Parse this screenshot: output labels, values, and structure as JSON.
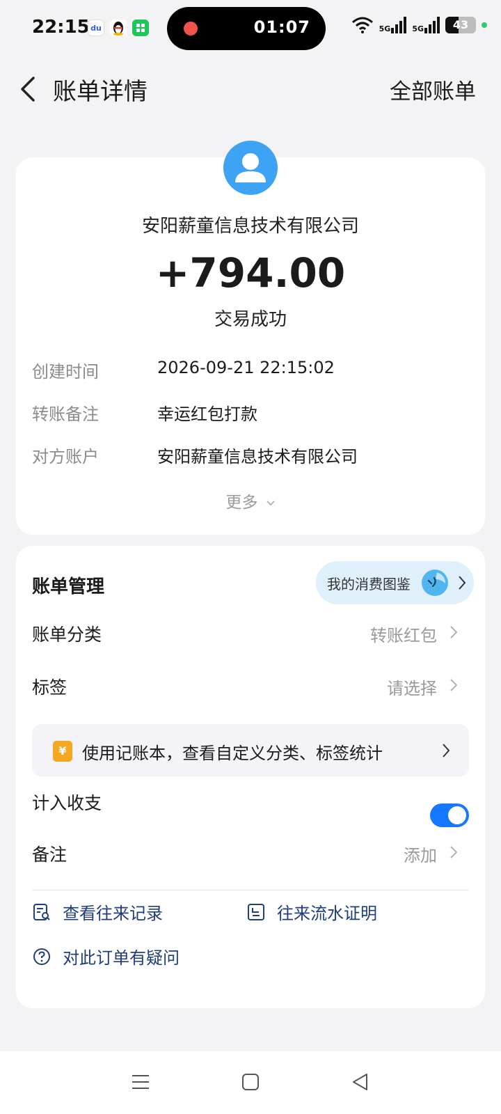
{
  "status_bar": {
    "time": "22:15",
    "apps": [
      "du",
      "qq-penguin",
      "green-app"
    ],
    "timer": "01:07",
    "network_1": "5G",
    "network_2": "5G",
    "battery": "43",
    "battery_level": 0.43
  },
  "header": {
    "title": "账单详情",
    "all_bills": "全部账单"
  },
  "transaction": {
    "payee": "安阳薪童信息技术有限公司",
    "amount": "+794.00",
    "status": "交易成功",
    "details": [
      {
        "label": "创建时间",
        "value": "2026-09-21 22:15:02"
      },
      {
        "label": "转账备注",
        "value": "幸运红包打款"
      },
      {
        "label": "对方账户",
        "value": "安阳薪童信息技术有限公司"
      }
    ],
    "more": "更多"
  },
  "management": {
    "title": "账单管理",
    "atlas_label": "我的消费图鉴",
    "category_label": "账单分类",
    "category_value": "转账红包",
    "tag_label": "标签",
    "tag_value": "请选择",
    "ledger_banner": "使用记账本，查看自定义分类、标签统计",
    "include_label": "计入收支",
    "include_enabled": true,
    "note_label": "备注",
    "note_value": "添加"
  },
  "links": {
    "history": "查看往来记录",
    "proof": "往来流水证明",
    "question": "对此订单有疑问"
  },
  "colors": {
    "accent": "#1677ff",
    "avatar": "#3ea3f5",
    "link": "#1f3c7d"
  }
}
